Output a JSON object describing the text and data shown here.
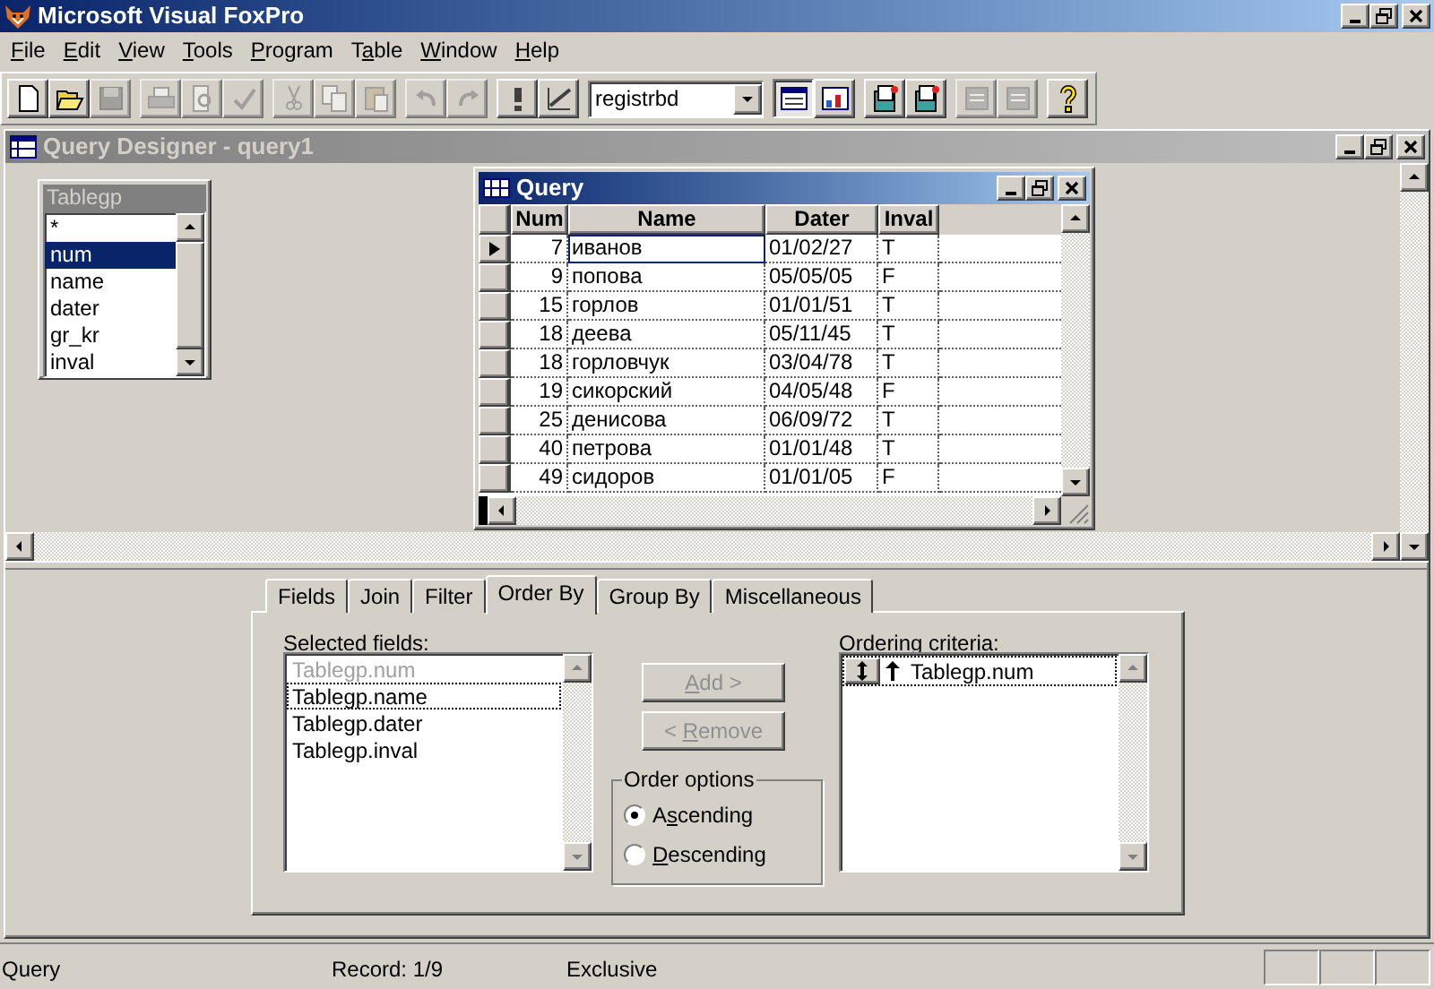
{
  "app_title": "Microsoft Visual FoxPro",
  "menu": [
    {
      "label": {
        "key": "F",
        "after": "ile"
      }
    },
    {
      "label": {
        "key": "E",
        "after": "dit"
      }
    },
    {
      "label": {
        "key": "V",
        "after": "iew"
      }
    },
    {
      "label": {
        "key": "T",
        "after": "ools"
      }
    },
    {
      "label": {
        "key": "P",
        "after": "rogram"
      }
    },
    {
      "label": {
        "before": "T",
        "key": "a",
        "after": "ble"
      }
    },
    {
      "label": {
        "key": "W",
        "after": "indow"
      }
    },
    {
      "label": {
        "key": "H",
        "after": "elp"
      }
    }
  ],
  "toolbar": [
    {
      "kind": "new",
      "disabled": false,
      "pressed": false
    },
    {
      "kind": "open",
      "disabled": false,
      "pressed": false
    },
    {
      "kind": "save",
      "disabled": true,
      "pressed": false
    },
    {
      "kind": "sep"
    },
    {
      "kind": "print",
      "disabled": true,
      "pressed": false
    },
    {
      "kind": "preview",
      "disabled": true,
      "pressed": false
    },
    {
      "kind": "spell",
      "disabled": true,
      "pressed": false
    },
    {
      "kind": "sep"
    },
    {
      "kind": "cut",
      "disabled": true,
      "pressed": false
    },
    {
      "kind": "copy",
      "disabled": true,
      "pressed": false
    },
    {
      "kind": "paste",
      "disabled": true,
      "pressed": false
    },
    {
      "kind": "sep"
    },
    {
      "kind": "undo",
      "disabled": true,
      "pressed": false
    },
    {
      "kind": "redo",
      "disabled": true,
      "pressed": false
    },
    {
      "kind": "sep"
    },
    {
      "kind": "run",
      "disabled": false,
      "pressed": false
    },
    {
      "kind": "wizard",
      "disabled": false,
      "pressed": false
    },
    {
      "kind": "combo",
      "value": "registrbd"
    },
    {
      "kind": "window",
      "disabled": false,
      "pressed": true
    },
    {
      "kind": "grid",
      "disabled": false,
      "pressed": false
    },
    {
      "kind": "sep"
    },
    {
      "kind": "builder",
      "disabled": false,
      "pressed": false
    },
    {
      "kind": "builder",
      "disabled": false,
      "pressed": false
    },
    {
      "kind": "sep"
    },
    {
      "kind": "form",
      "disabled": true,
      "pressed": false
    },
    {
      "kind": "form",
      "disabled": true,
      "pressed": false
    },
    {
      "kind": "sep"
    },
    {
      "kind": "help",
      "disabled": false,
      "pressed": false
    }
  ],
  "designer": {
    "title": "Query Designer - query1",
    "table_box": {
      "title": "Tablegp",
      "fields": [
        {
          "label": "*",
          "selected": false
        },
        {
          "label": "num",
          "selected": true
        },
        {
          "label": "name",
          "selected": false
        },
        {
          "label": "dater",
          "selected": false
        },
        {
          "label": "gr_kr",
          "selected": false
        },
        {
          "label": "inval",
          "selected": false
        }
      ]
    },
    "tabs": [
      {
        "label": "Fields",
        "selected": false
      },
      {
        "label": "Join",
        "selected": false
      },
      {
        "label": "Filter",
        "selected": false
      },
      {
        "label": "Order By",
        "selected": true
      },
      {
        "label": "Group By",
        "selected": false
      },
      {
        "label": "Miscellaneous",
        "selected": false
      }
    ],
    "selected_fields": {
      "label": {
        "before": "Sel",
        "key": "e",
        "after": "cted fields:"
      },
      "items": [
        {
          "label": "Tablegp.num",
          "disabled": true,
          "focused": false
        },
        {
          "label": "Tablegp.name",
          "disabled": false,
          "focused": true
        },
        {
          "label": "Tablegp.dater",
          "disabled": false,
          "focused": false
        },
        {
          "label": "Tablegp.inval",
          "disabled": false,
          "focused": false
        }
      ]
    },
    "buttons": [
      {
        "label": {
          "key": "A",
          "after": "dd >"
        },
        "disabled": true
      },
      {
        "label": {
          "before": "< ",
          "key": "R",
          "after": "emove"
        },
        "disabled": true
      }
    ],
    "order_options": {
      "title": "Order options",
      "options": [
        {
          "label": {
            "before": "A",
            "key": "s",
            "after": "cending"
          },
          "selected": true
        },
        {
          "label": {
            "key": "D",
            "after": "escending"
          },
          "selected": false
        }
      ]
    },
    "ordering_criteria": {
      "label": {
        "key": "O",
        "after": "rdering criteria:"
      },
      "items": [
        {
          "label": "Tablegp.num",
          "ascending": true
        }
      ]
    }
  },
  "query_window": {
    "title": "Query",
    "columns": [
      {
        "label": "Num",
        "numeric": true
      },
      {
        "label": "Name",
        "numeric": false
      },
      {
        "label": "Dater",
        "numeric": false
      },
      {
        "label": "Inval",
        "numeric": false
      }
    ],
    "rows": [
      {
        "cells": [
          "7",
          "иванов",
          "01/02/27",
          "T"
        ],
        "current": true
      },
      {
        "cells": [
          "9",
          "попова",
          "05/05/05",
          "F"
        ],
        "current": false
      },
      {
        "cells": [
          "15",
          "горлов",
          "01/01/51",
          "T"
        ],
        "current": false
      },
      {
        "cells": [
          "18",
          "деева",
          "05/11/45",
          "T"
        ],
        "current": false
      },
      {
        "cells": [
          "18",
          "горловчук",
          "03/04/78",
          "T"
        ],
        "current": false
      },
      {
        "cells": [
          "19",
          "сикорский",
          "04/05/48",
          "F"
        ],
        "current": false
      },
      {
        "cells": [
          "25",
          "денисова",
          "06/09/72",
          "T"
        ],
        "current": false
      },
      {
        "cells": [
          "40",
          "петрова",
          "01/01/48",
          "T"
        ],
        "current": false
      },
      {
        "cells": [
          "49",
          "сидоров",
          "01/01/05",
          "F"
        ],
        "current": false
      }
    ]
  },
  "status_bar": {
    "mode": "Query",
    "record": "Record: 1/9",
    "access": "Exclusive"
  }
}
